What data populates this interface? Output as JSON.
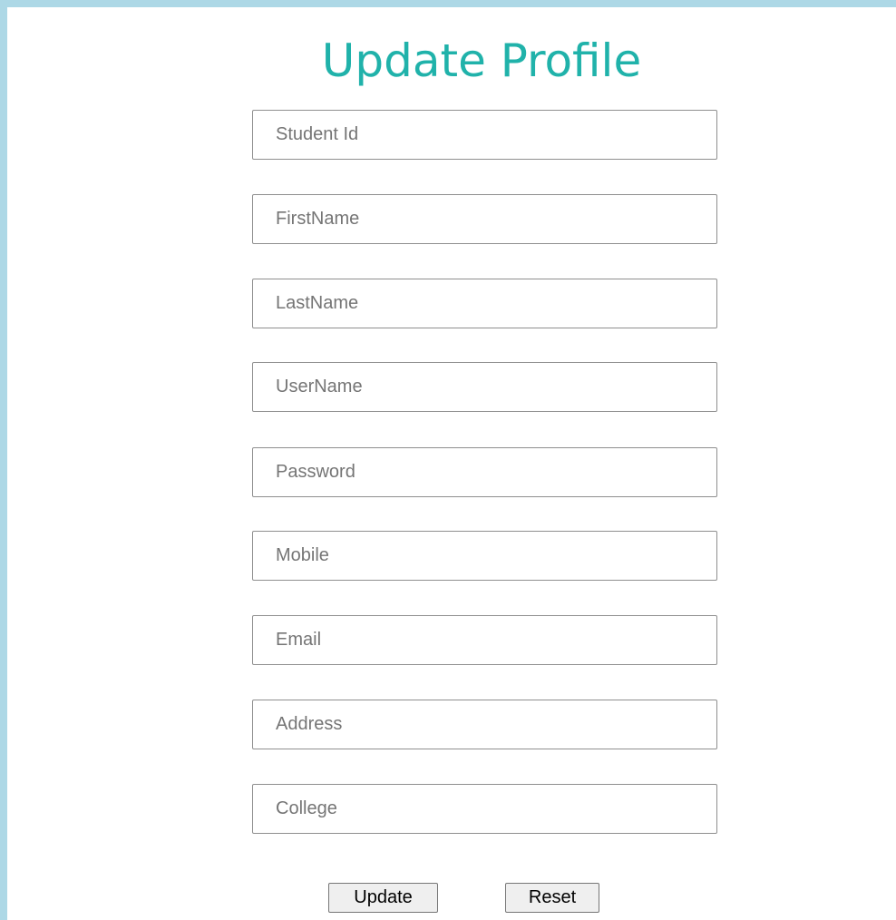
{
  "page": {
    "title": "Update Profile",
    "accent_color": "#20b2aa",
    "frame_color": "#add8e6"
  },
  "form": {
    "fields": [
      {
        "placeholder": "Student Id",
        "value": ""
      },
      {
        "placeholder": "FirstName",
        "value": ""
      },
      {
        "placeholder": "LastName",
        "value": ""
      },
      {
        "placeholder": "UserName",
        "value": ""
      },
      {
        "placeholder": "Password",
        "value": ""
      },
      {
        "placeholder": "Mobile",
        "value": ""
      },
      {
        "placeholder": "Email",
        "value": ""
      },
      {
        "placeholder": "Address",
        "value": ""
      },
      {
        "placeholder": "College",
        "value": ""
      }
    ],
    "update_label": "Update",
    "reset_label": "Reset"
  }
}
